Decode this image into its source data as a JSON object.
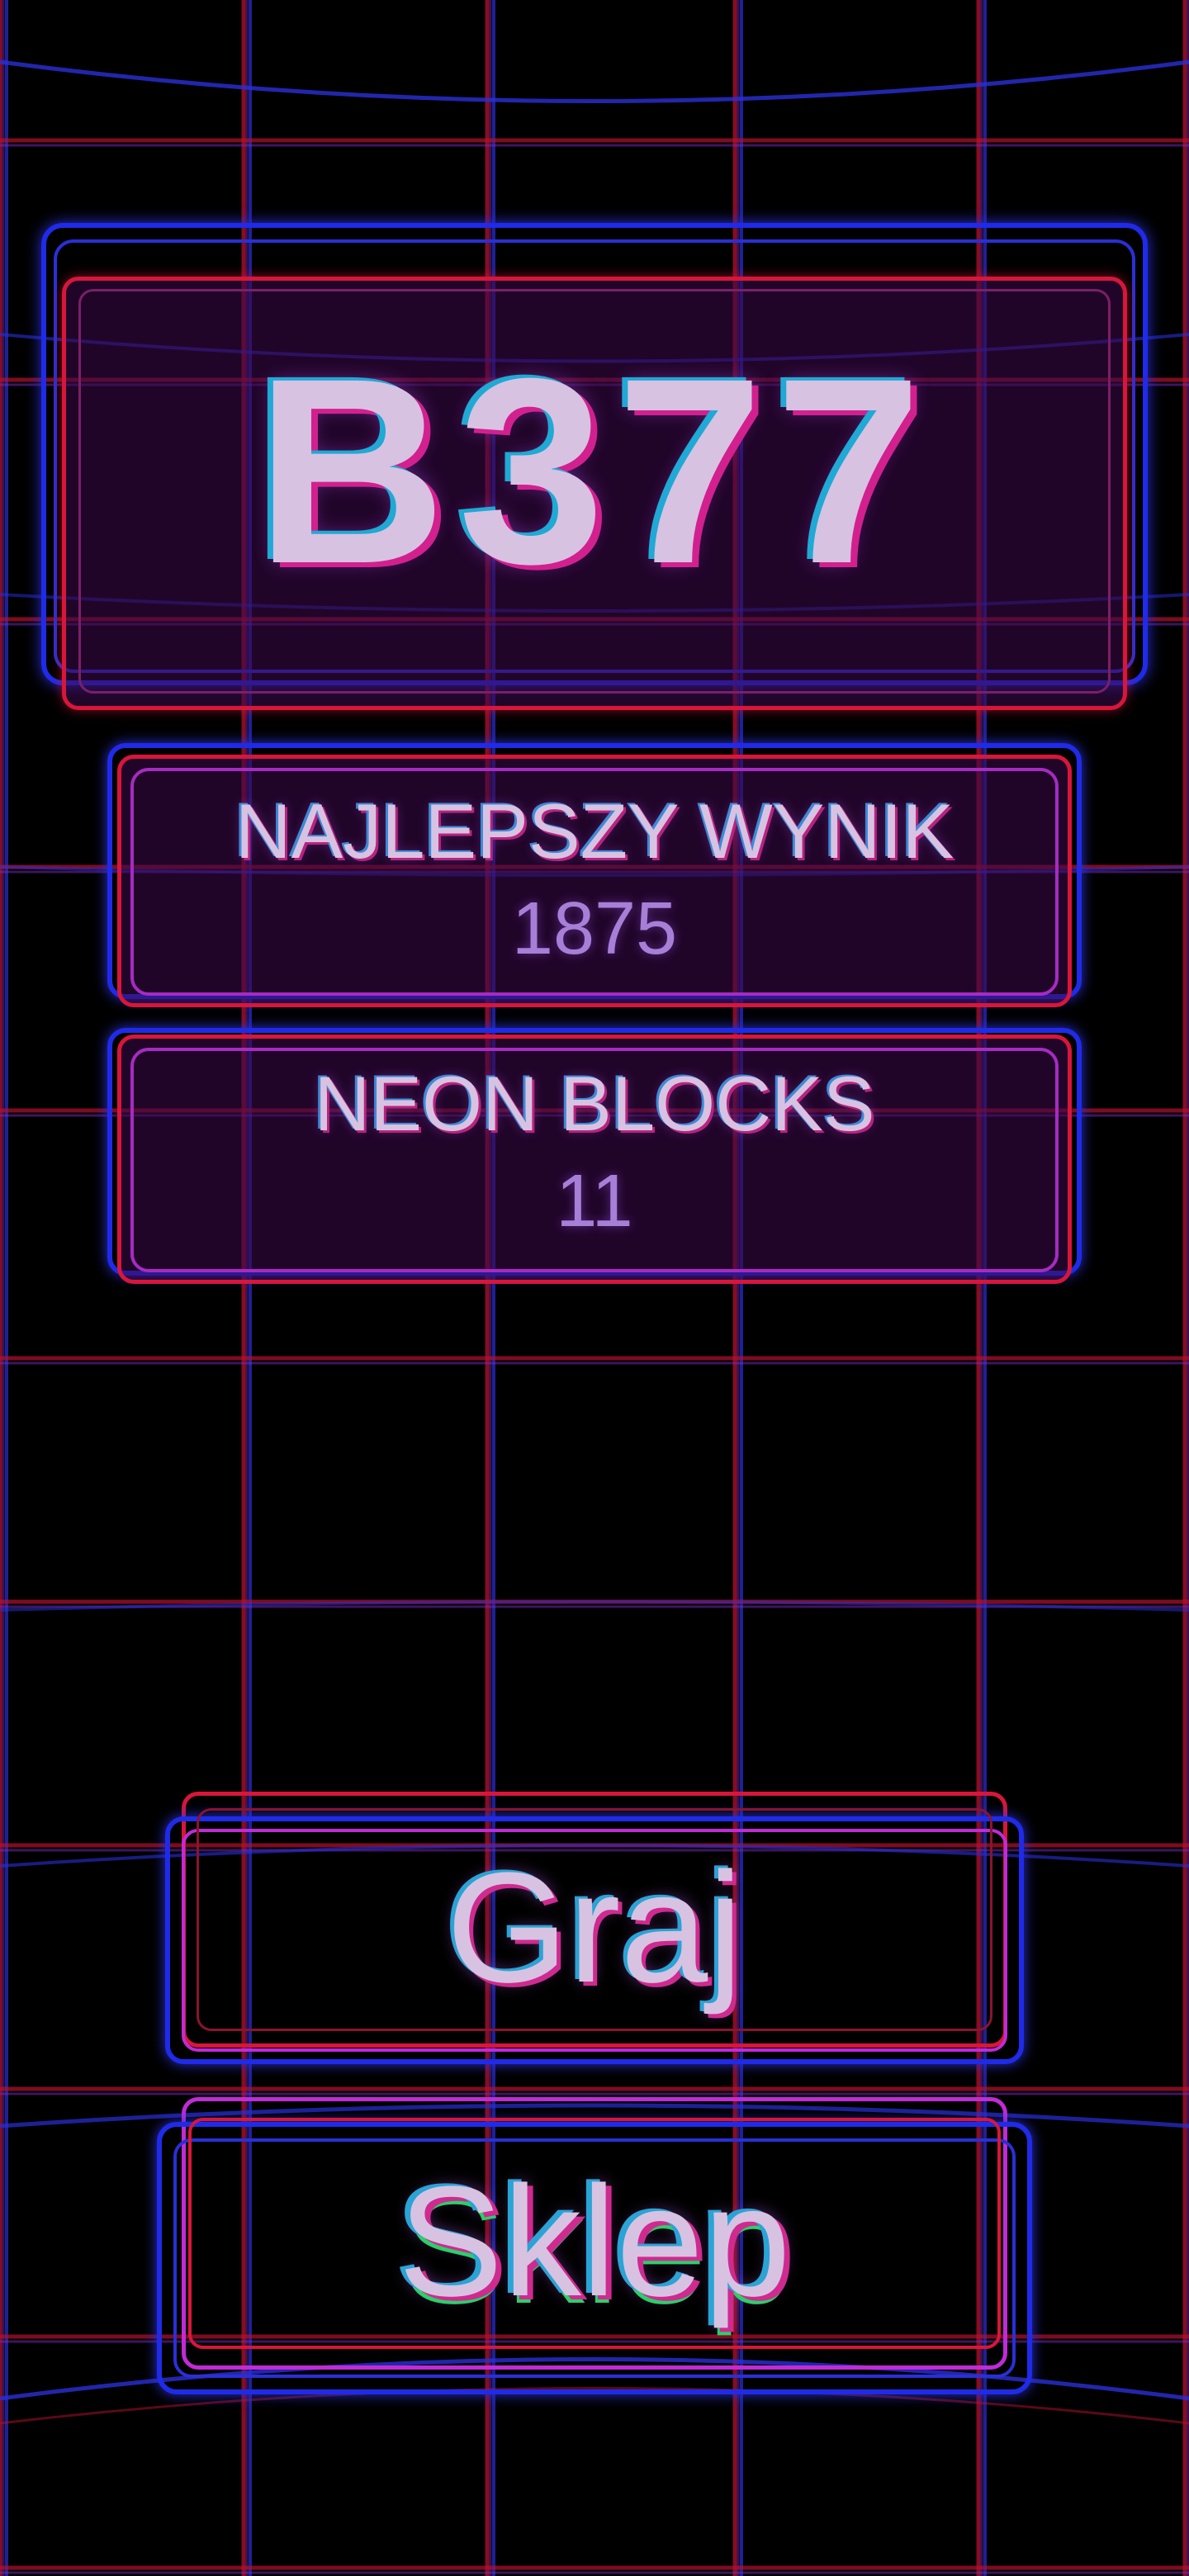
{
  "logo": {
    "text": "B377"
  },
  "best_score": {
    "label": "NAJLEPSZY WYNIK",
    "value": "1875"
  },
  "neon_blocks": {
    "label": "NEON BLOCKS",
    "value": "11"
  },
  "buttons": {
    "play_label": "Graj",
    "shop_label": "Sklep"
  },
  "colors": {
    "background": "#000000",
    "grid_red": "#b3122e",
    "grid_blue": "#2a2fd6",
    "grid_violet": "#7b2bb8",
    "frame_blue": "#1f2be8",
    "frame_red": "#d8163a",
    "frame_magenta": "#c02bd6",
    "text": "#d8c2e2",
    "value_text": "#a77fd6"
  }
}
